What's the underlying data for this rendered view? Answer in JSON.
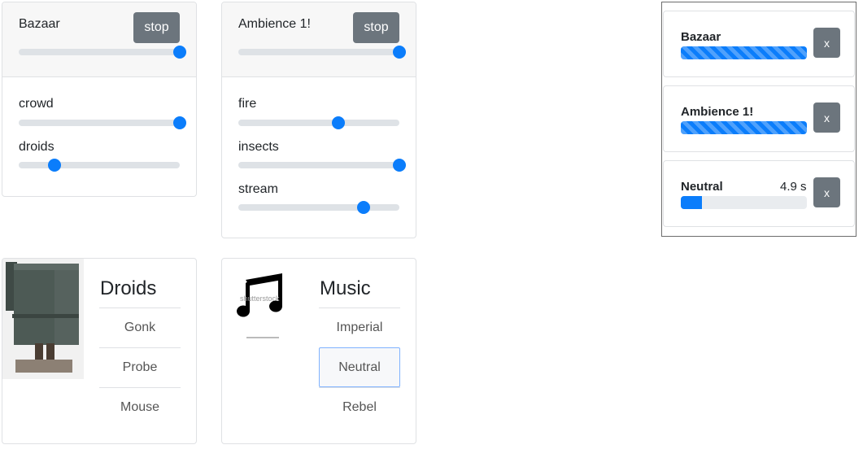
{
  "scenes": [
    {
      "title": "Bazaar",
      "stop_label": "stop",
      "master_level": 1.0,
      "tracks": [
        {
          "label": "crowd",
          "level": 1.0
        },
        {
          "label": "droids",
          "level": 0.22
        }
      ]
    },
    {
      "title": "Ambience 1!",
      "stop_label": "stop",
      "master_level": 1.0,
      "tracks": [
        {
          "label": "fire",
          "level": 0.62
        },
        {
          "label": "insects",
          "level": 1.0
        },
        {
          "label": "stream",
          "level": 0.78
        }
      ]
    }
  ],
  "playing": [
    {
      "name": "Bazaar",
      "time": "",
      "progress": 1.0,
      "striped": true,
      "remove_label": "x"
    },
    {
      "name": "Ambience 1!",
      "time": "",
      "progress": 1.0,
      "striped": true,
      "remove_label": "x"
    },
    {
      "name": "Neutral",
      "time": "4.9 s",
      "progress": 0.17,
      "striped": false,
      "remove_label": "x"
    }
  ],
  "libraries": [
    {
      "title": "Droids",
      "items": [
        "Gonk",
        "Probe",
        "Mouse"
      ],
      "active": -1,
      "image": "gonk-droid-image"
    },
    {
      "title": "Music",
      "items": [
        "Imperial",
        "Neutral",
        "Rebel"
      ],
      "active": 1,
      "image": "music-note-icon",
      "watermark": "shutterstock"
    }
  ],
  "colors": {
    "accent": "#0b7dfb",
    "button": "#6c757d",
    "track": "#dee2e6"
  }
}
